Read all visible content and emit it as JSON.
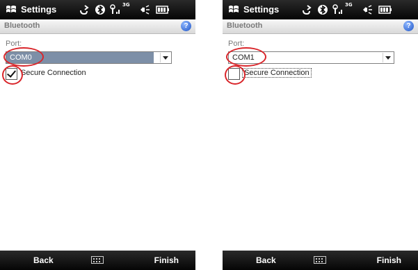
{
  "screens": [
    {
      "status_bar": {
        "app_title": "Settings",
        "network_label": "3G",
        "icons": [
          "windows-flag-icon",
          "call-forward-icon",
          "bluetooth-icon",
          "signal-icon",
          "volume-icon",
          "battery-icon"
        ]
      },
      "header": {
        "title": "Bluetooth",
        "help_icon": "question-mark-icon",
        "help_glyph": "?"
      },
      "port": {
        "label": "Port:",
        "value": "COM0",
        "highlighted": true
      },
      "secure_connection": {
        "label": "Secure Connection",
        "checked": true
      },
      "softkeys": {
        "left": "Back",
        "right": "Finish",
        "center_icon": "keyboard-icon"
      }
    },
    {
      "status_bar": {
        "app_title": "Settings",
        "network_label": "3G",
        "icons": [
          "windows-flag-icon",
          "call-forward-icon",
          "bluetooth-icon",
          "signal-icon",
          "volume-icon",
          "battery-icon"
        ]
      },
      "header": {
        "title": "Bluetooth",
        "help_icon": "question-mark-icon",
        "help_glyph": "?"
      },
      "port": {
        "label": "Port:",
        "value": "COM1",
        "highlighted": false
      },
      "secure_connection": {
        "label": "Secure Connection",
        "checked": false
      },
      "softkeys": {
        "left": "Back",
        "right": "Finish",
        "center_icon": "keyboard-icon"
      }
    }
  ],
  "colors": {
    "bar_dark": "#050505",
    "selection_blue": "#7d8fa7",
    "annotation_red": "#d9262b",
    "help_blue": "#1f55c7"
  }
}
